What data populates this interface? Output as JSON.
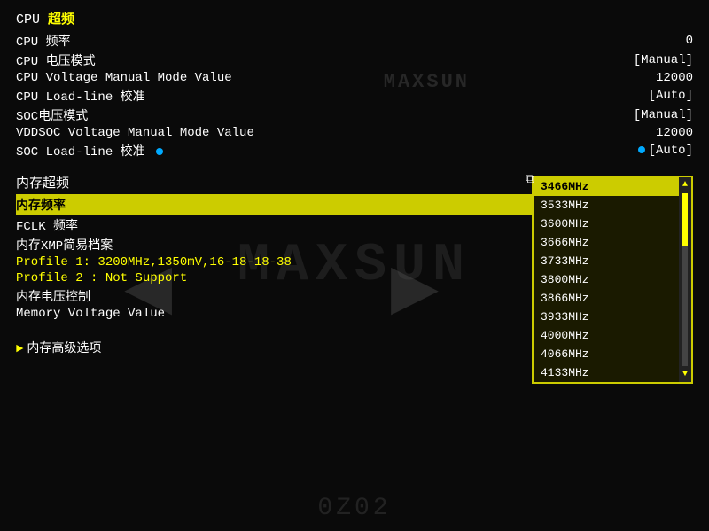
{
  "bios": {
    "sections": {
      "cpu_overclock": {
        "title_prefix": "CPU",
        "title_highlight": "超频"
      },
      "cpu_items": [
        {
          "label": "CPU 频率",
          "value": "0"
        },
        {
          "label": "CPU 电压模式",
          "value": "[Manual]"
        },
        {
          "label": "CPU Voltage Manual Mode Value",
          "value": "12000"
        },
        {
          "label": "CPU Load-line 校准",
          "value": "[Auto]"
        },
        {
          "label": "SOC电压模式",
          "value": "[Manual]"
        },
        {
          "label": "VDDSOC Voltage Manual Mode Value",
          "value": "12000"
        },
        {
          "label": "SOC Load-line 校准",
          "value": "[Auto]",
          "has_dots": true
        }
      ],
      "memory_overclock": {
        "title": "内存超频"
      },
      "memory_items": [
        {
          "label": "内存频率",
          "value": "[3466MHz]",
          "highlighted": true
        },
        {
          "label": "FCLK 频率",
          "value": ""
        },
        {
          "label": "内存XMP简易档案",
          "value": ""
        }
      ],
      "xmp_profiles": [
        {
          "text": "Profile 1: 3200MHz,1350mV,16-18-18-38",
          "color": "yellow"
        },
        {
          "text": "Profile 2 : Not Support",
          "color": "yellow"
        }
      ],
      "extra_items": [
        {
          "label": "内存电压控制",
          "value": ""
        },
        {
          "label": "Memory Voltage Value",
          "value": ""
        }
      ],
      "advanced": {
        "label": "内存高级选项",
        "has_pointer": true
      }
    },
    "dropdown": {
      "items": [
        {
          "label": "3466MHz",
          "selected": true
        },
        {
          "label": "3533MHz",
          "selected": false
        },
        {
          "label": "3600MHz",
          "selected": false
        },
        {
          "label": "3666MHz",
          "selected": false
        },
        {
          "label": "3733MHz",
          "selected": false
        },
        {
          "label": "3800MHz",
          "selected": false
        },
        {
          "label": "3866MHz",
          "selected": false
        },
        {
          "label": "3933MHz",
          "selected": false
        },
        {
          "label": "4000MHz",
          "selected": false
        },
        {
          "label": "4066MHz",
          "selected": false
        },
        {
          "label": "4133MHz",
          "selected": false
        }
      ]
    },
    "bg_logo": "MAXSUN",
    "bottom_numbers": "0Z02"
  }
}
